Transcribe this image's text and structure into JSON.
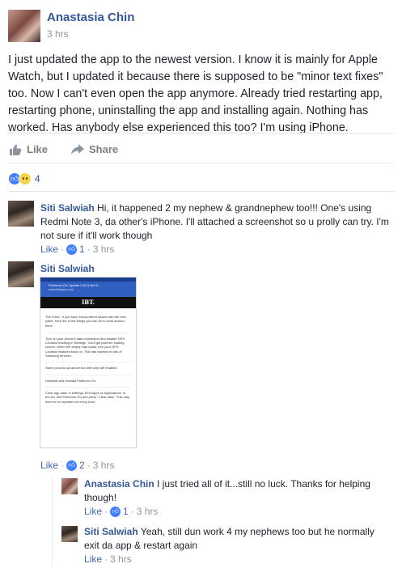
{
  "post": {
    "author": "Anastasia Chin",
    "time": "3 hrs",
    "text": "I just updated the app to the newest version. I know it is mainly for Apple Watch, but I updated it because there is supposed to be \"minor text fixes\" too. Now I can't even open the app anymore. Already tried restarting app, restarting phone, uninstalling the app and installing again. Nothing has worked. Has anybody else experienced this too? I'm using iPhone.",
    "like_label": "Like",
    "share_label": "Share",
    "reactions": {
      "icons": [
        "like-icon",
        "sad-icon"
      ],
      "count": "4"
    }
  },
  "comments": [
    {
      "author": "Siti Salwiah",
      "text": "Hi, it happened 2 my nephew & grandnephew too!!! One's using Redmi Note 3, da other's iPhone. I'll attached a screenshot so u prolly can try. I'm not sure if it'll work though",
      "like_label": "Like",
      "likes": "1",
      "time": "3 hrs"
    },
    {
      "author": "Siti Salwiah",
      "attachment": {
        "title": "Pokémon Go' Update 2.51.5 Not S...",
        "url": "www.ibtimes.com",
        "logo": "IBT.",
        "intro": "The Fixes : If you have encountered issues with the new patch, here are a few things you can do to work around them",
        "items": [
          "Turn on your phone's data connection and disable GPS Location tracking in Settings. You'll get past the loading screen. When the empty map loads, turn your GPS Location features back on. This has worked on lots of Samsung devices.",
          "Same process as above but with only wifi enabled",
          "Uninstall and reinstall Pokémon Go",
          "Clear app data: In settings, Find Apps or Applications. In the list, find Pokémon Go and press \"Clear data.\" This may have to be repeated on every boot."
        ]
      },
      "like_label": "Like",
      "likes": "2",
      "time": "3 hrs"
    }
  ],
  "replies": [
    {
      "author": "Anastasia Chin",
      "text": "I just tried all of it...still no luck. Thanks for helping though!",
      "like_label": "Like",
      "likes": "1",
      "time": "3 hrs"
    },
    {
      "author": "Siti Salwiah",
      "text": "Yeah, still dun work 4 my nephews too but he normally exit da app & restart again",
      "like_label": "Like",
      "time": "3 hrs"
    }
  ]
}
